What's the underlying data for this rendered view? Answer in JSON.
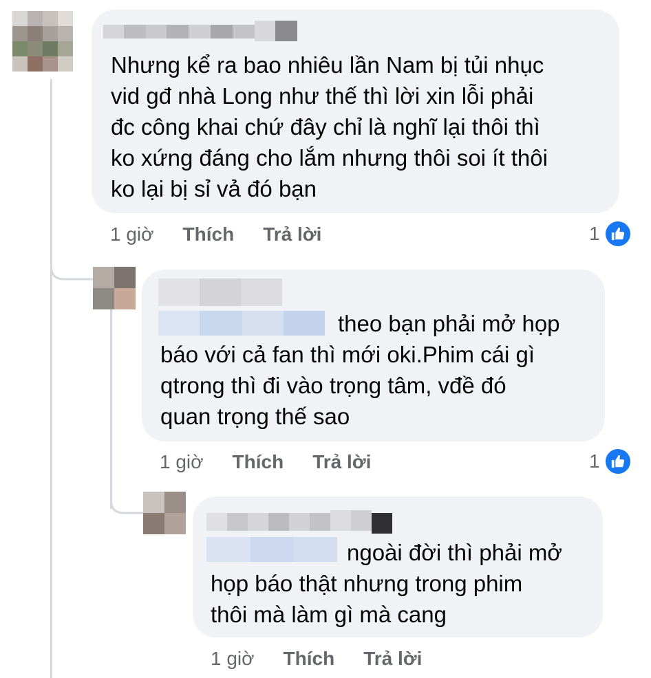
{
  "comments": [
    {
      "text": "Nhưng kể ra bao nhiêu lần Nam bị tủi nhục\nvid gđ nhà Long như thế thì lời xin lỗi phải\nđc công khai chứ đây chỉ là nghĩ lại thôi thì\nko xứng đáng cho lắm nhưng thôi soi ít thôi\nko lại bị sỉ vả đó bạn",
      "time": "1 giờ",
      "like_label": "Thích",
      "reply_label": "Trả lời",
      "reaction_count": "1"
    },
    {
      "text": "theo bạn phải mở họp\nbáo với cả fan thì mới oki.Phim cái gì\nqtrong thì đi vào trọng tâm, vđề đó\nquan trọng thế sao",
      "time": "1 giờ",
      "like_label": "Thích",
      "reply_label": "Trả lời",
      "reaction_count": "1"
    },
    {
      "text": "ngoài đời thì phải mở\nhọp báo thật nhưng trong phim\nthôi mà làm gì mà cang",
      "time": "1 giờ",
      "like_label": "Thích",
      "reply_label": "Trả lời"
    }
  ],
  "icons": {
    "like": "thumbs-up-icon"
  },
  "colors": {
    "bubble": "#f0f2f5",
    "like_badge": "#1877f2",
    "meta_text": "#65676b"
  }
}
